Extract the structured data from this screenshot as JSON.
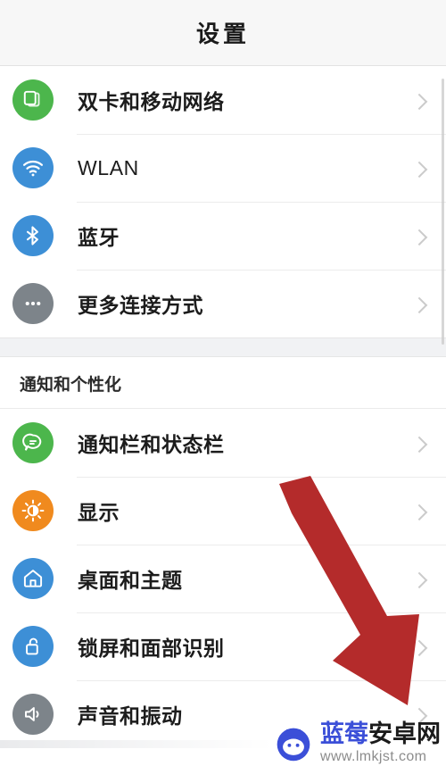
{
  "header": {
    "title": "设置"
  },
  "groups": [
    {
      "name": "connectivity",
      "items": [
        {
          "label": "双卡和移动网络",
          "icon": "sim-card-icon",
          "icon_color": "#4cb64c",
          "chevron": "chevron-right-icon",
          "latin": false
        },
        {
          "label": "WLAN",
          "icon": "wifi-icon",
          "icon_color": "#3d8fd6",
          "chevron": "chevron-right-icon",
          "latin": true
        },
        {
          "label": "蓝牙",
          "icon": "bluetooth-icon",
          "icon_color": "#3d8fd6",
          "chevron": "chevron-right-icon",
          "latin": false
        },
        {
          "label": "更多连接方式",
          "icon": "ellipsis-icon",
          "icon_color": "#7d848a",
          "chevron": "chevron-right-icon",
          "latin": false
        }
      ]
    }
  ],
  "section": {
    "label": "通知和个性化"
  },
  "section_items": [
    {
      "label": "通知栏和状态栏",
      "icon": "chat-bubble-icon",
      "icon_color": "#4cb64c",
      "chevron": "chevron-right-icon",
      "latin": false
    },
    {
      "label": "显示",
      "icon": "brightness-icon",
      "icon_color": "#f08a1e",
      "chevron": "chevron-right-icon",
      "latin": false
    },
    {
      "label": "桌面和主题",
      "icon": "home-icon",
      "icon_color": "#3d8fd6",
      "chevron": "chevron-right-icon",
      "latin": false
    },
    {
      "label": "锁屏和面部识别",
      "icon": "unlock-icon",
      "icon_color": "#3d8fd6",
      "chevron": "chevron-right-icon",
      "latin": false
    },
    {
      "label": "声音和振动",
      "icon": "speaker-icon",
      "icon_color": "#7d848a",
      "chevron": "chevron-right-icon",
      "latin": false
    }
  ],
  "annotation": {
    "name": "red-arrow",
    "color": "#b42b2b"
  },
  "watermark": {
    "name_blue": "蓝莓",
    "name_dark": "安卓网",
    "url": "www.lmkjst.com",
    "logo": "android-robot-icon",
    "logo_color": "#3b4fd8"
  },
  "scrollbar": {
    "name": "vertical-scrollbar"
  }
}
